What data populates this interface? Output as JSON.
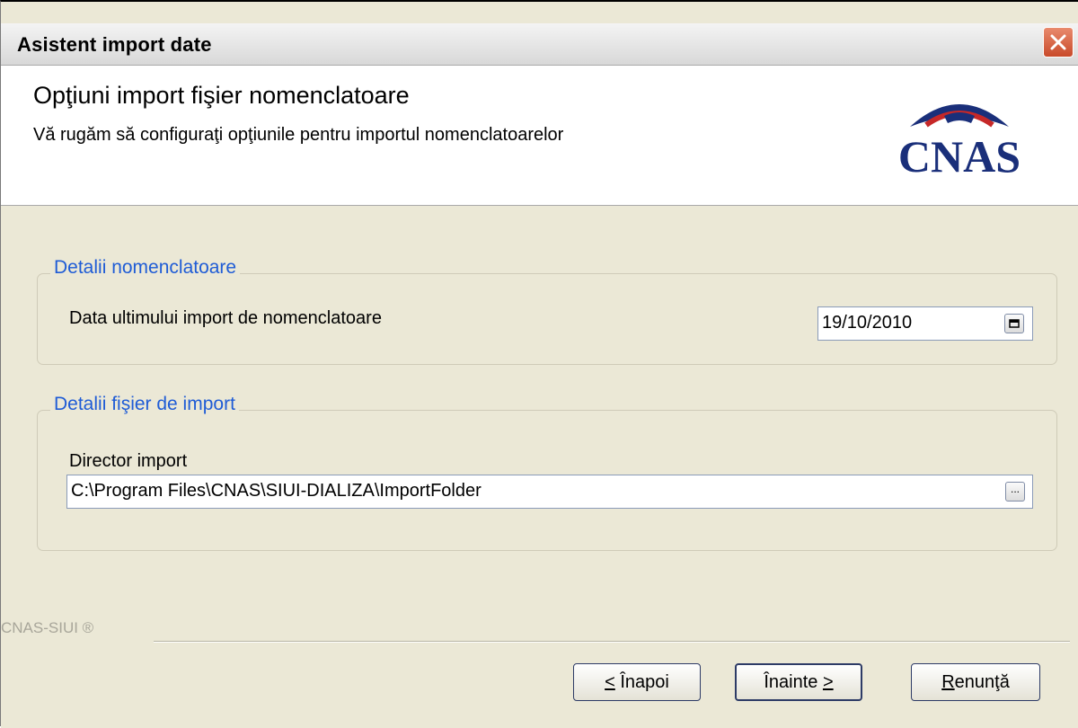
{
  "window": {
    "title": "Asistent import date"
  },
  "header": {
    "title": "Opţiuni import fişier nomenclatoare",
    "subtitle": "Vă rugăm să configuraţi opţiunile pentru importul nomenclatoarelor",
    "logo_text": "CNAS"
  },
  "group_nomenclatoare": {
    "legend": "Detalii nomenclatoare",
    "date_label": "Data ultimului import de nomenclatoare",
    "date_value": "19/10/2010"
  },
  "group_fisier": {
    "legend": "Detalii fişier de import",
    "dir_label": "Director import",
    "dir_value": "C:\\Program Files\\CNAS\\SIUI-DIALIZA\\ImportFolder",
    "browse_label": "..."
  },
  "footer": {
    "brand": "CNAS-SIUI ®"
  },
  "buttons": {
    "back_prefix": "<",
    "back_label": " Înapoi",
    "next_label": "Înainte ",
    "next_suffix": ">",
    "cancel_first": "R",
    "cancel_rest": "enunţă"
  },
  "colors": {
    "legend": "#1f5cd6",
    "logo_red": "#c62828",
    "logo_blue": "#1a2f7a"
  }
}
